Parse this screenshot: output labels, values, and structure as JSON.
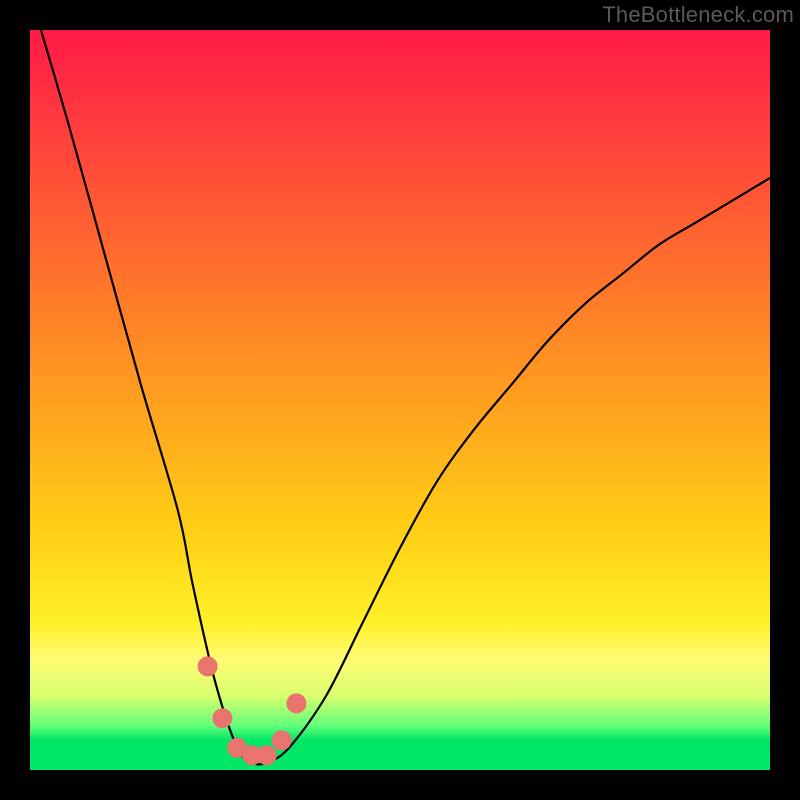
{
  "watermark": "TheBottleneck.com",
  "chart_data": {
    "type": "line",
    "title": "",
    "xlabel": "",
    "ylabel": "",
    "xlim": [
      0,
      100
    ],
    "ylim": [
      0,
      100
    ],
    "series": [
      {
        "name": "bottleneck-curve",
        "x": [
          0,
          5,
          10,
          15,
          20,
          22,
          25,
          28,
          30,
          32,
          35,
          40,
          45,
          50,
          55,
          60,
          65,
          70,
          75,
          80,
          85,
          90,
          95,
          100
        ],
        "values": [
          105,
          88,
          70,
          52,
          35,
          25,
          12,
          3,
          1,
          1,
          3,
          10,
          20,
          30,
          39,
          46,
          52,
          58,
          63,
          67,
          71,
          74,
          77,
          80
        ]
      }
    ],
    "markers": {
      "name": "highlight-points",
      "x": [
        24,
        26,
        28,
        30,
        32,
        34,
        36
      ],
      "values": [
        14,
        7,
        3,
        2,
        2,
        4,
        9
      ],
      "radius": 10,
      "color": "#e9736d"
    },
    "gradient_stops": [
      {
        "pos": 0.0,
        "color": "#ff1a46"
      },
      {
        "pos": 0.3,
        "color": "#ff6a2e"
      },
      {
        "pos": 0.68,
        "color": "#ffd015"
      },
      {
        "pos": 0.85,
        "color": "#fffb74"
      },
      {
        "pos": 0.94,
        "color": "#63ff7a"
      },
      {
        "pos": 1.0,
        "color": "#00e765"
      }
    ]
  }
}
